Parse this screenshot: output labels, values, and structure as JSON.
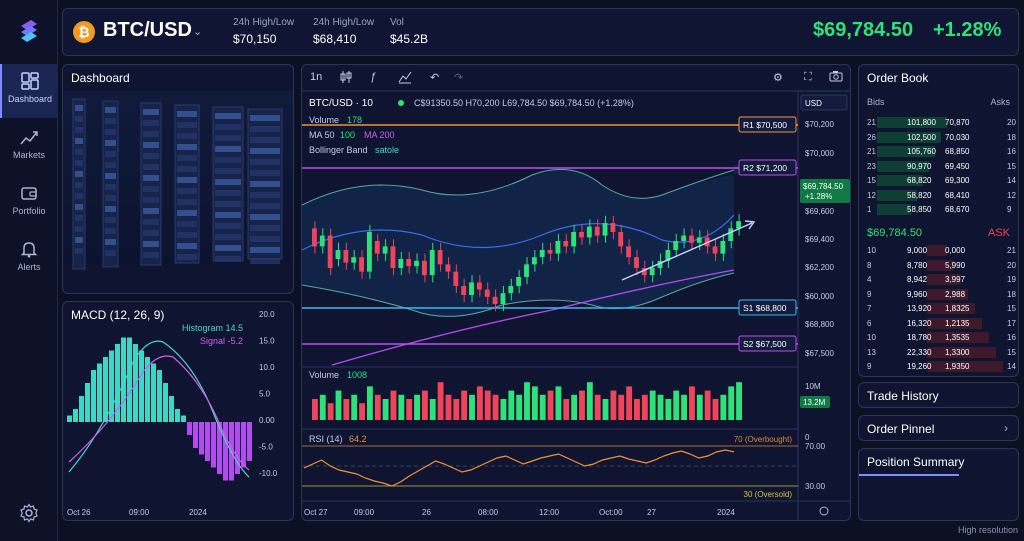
{
  "nav": {
    "items": [
      {
        "label": "Dashboard",
        "icon": "dashboard-icon"
      },
      {
        "label": "Markets",
        "icon": "chart-icon"
      },
      {
        "label": "Portfolio",
        "icon": "wallet-icon"
      },
      {
        "label": "Alerts",
        "icon": "bell-icon"
      }
    ]
  },
  "header": {
    "coin_symbol": "₿",
    "pair": "BTC/USD",
    "stats": [
      {
        "label": "24h High/Low",
        "value": "$70,150"
      },
      {
        "label": "24h High/Low",
        "value": "$68,410"
      },
      {
        "label": "Vol",
        "value": "$45.2B"
      }
    ],
    "price": "$69,784.50",
    "change": "+1.28%"
  },
  "dashboard": {
    "title": "Dashboard"
  },
  "macd": {
    "title": "MACD (12, 26, 9)",
    "histogram_label": "Histogram 14.5",
    "signal_label": "Signal -5.2",
    "yticks": [
      "20.0",
      "15.0",
      "10.0",
      "5.0",
      "0.00",
      "-5.0",
      "-10.0"
    ],
    "xticks": [
      "Oct 26",
      "09:00",
      "2024"
    ]
  },
  "chart_toolbar": {
    "interval": "1n"
  },
  "chart": {
    "legend": {
      "pair_label": "BTC/USD · 10",
      "ohlc": "C$91350.50  H70,200  L69,784.50  $69,784.50 (+1.28%)",
      "volume_label": "Volume",
      "volume_value": "178",
      "ma_label": "MA 50",
      "ma_value": "100",
      "ma2_label": "MA 200",
      "bb_label": "Bollinger Band",
      "bb_value": "satole"
    },
    "currency": "USD",
    "price_axis": [
      "$70,200",
      "$70,000",
      "$69,600",
      "$69,400",
      "$62,200",
      "$60,000",
      "$68,800",
      "$67,500"
    ],
    "levels": [
      {
        "label": "R1 $70,500",
        "color": "#f0923a"
      },
      {
        "label": "R2 $71,200",
        "color": "#c04cf0"
      },
      {
        "label": "S1 $68,800",
        "color": "#3ab8f0"
      },
      {
        "label": "S2 $67,500",
        "color": "#c04cf0"
      }
    ],
    "price_tag": "$69,784.50",
    "price_tag_change": "+1.28%",
    "volume_title": "Volume",
    "volume_value": "1008",
    "volume_axis": [
      "10M",
      "13.2M",
      "0"
    ],
    "rsi_title": "RSI (14)",
    "rsi_value": "64.2",
    "rsi_overbought": "70 (Overbought)",
    "rsi_oversold": "30 (Oversold)",
    "rsi_axis": [
      "70.00",
      "30.00"
    ],
    "time_axis": [
      "Oct 27",
      "09:00",
      "26",
      "08:00",
      "12:00",
      "Oct:00",
      "27",
      "2024"
    ]
  },
  "chart_data": {
    "type": "candlestick",
    "candles": [
      [
        0.62,
        0.52
      ],
      [
        0.52,
        0.58
      ],
      [
        0.58,
        0.4
      ],
      [
        0.45,
        0.5
      ],
      [
        0.5,
        0.43
      ],
      [
        0.43,
        0.46
      ],
      [
        0.46,
        0.38
      ],
      [
        0.38,
        0.6
      ],
      [
        0.55,
        0.48
      ],
      [
        0.48,
        0.52
      ],
      [
        0.52,
        0.4
      ],
      [
        0.4,
        0.45
      ],
      [
        0.45,
        0.41
      ],
      [
        0.41,
        0.44
      ],
      [
        0.44,
        0.36
      ],
      [
        0.36,
        0.5
      ],
      [
        0.5,
        0.42
      ],
      [
        0.42,
        0.38
      ],
      [
        0.38,
        0.3
      ],
      [
        0.3,
        0.25
      ],
      [
        0.25,
        0.32
      ],
      [
        0.32,
        0.28
      ],
      [
        0.28,
        0.24
      ],
      [
        0.24,
        0.2
      ],
      [
        0.2,
        0.26
      ],
      [
        0.26,
        0.3
      ],
      [
        0.3,
        0.35
      ],
      [
        0.35,
        0.42
      ],
      [
        0.42,
        0.46
      ],
      [
        0.46,
        0.5
      ],
      [
        0.5,
        0.48
      ],
      [
        0.48,
        0.55
      ],
      [
        0.55,
        0.52
      ],
      [
        0.52,
        0.6
      ],
      [
        0.6,
        0.57
      ],
      [
        0.57,
        0.63
      ],
      [
        0.63,
        0.58
      ],
      [
        0.58,
        0.65
      ],
      [
        0.65,
        0.6
      ],
      [
        0.6,
        0.52
      ],
      [
        0.52,
        0.46
      ],
      [
        0.46,
        0.4
      ],
      [
        0.4,
        0.36
      ],
      [
        0.36,
        0.4
      ],
      [
        0.4,
        0.44
      ],
      [
        0.44,
        0.5
      ],
      [
        0.5,
        0.55
      ],
      [
        0.55,
        0.58
      ],
      [
        0.58,
        0.54
      ],
      [
        0.54,
        0.57
      ],
      [
        0.57,
        0.52
      ],
      [
        0.52,
        0.48
      ],
      [
        0.48,
        0.55
      ],
      [
        0.55,
        0.62
      ],
      [
        0.62,
        0.66
      ]
    ],
    "volume": [
      5,
      6,
      4,
      7,
      5,
      6,
      4,
      8,
      6,
      5,
      7,
      6,
      5,
      6,
      7,
      5,
      9,
      6,
      5,
      7,
      6,
      8,
      7,
      6,
      5,
      7,
      6,
      9,
      8,
      6,
      7,
      8,
      5,
      6,
      7,
      9,
      6,
      5,
      7,
      6,
      8,
      5,
      6,
      7,
      6,
      5,
      7,
      6,
      8,
      6,
      7,
      5,
      6,
      8,
      9
    ],
    "rsi": [
      48,
      52,
      56,
      50,
      46,
      44,
      42,
      38,
      35,
      33,
      30,
      34,
      40,
      45,
      50,
      55,
      52,
      48,
      44,
      46,
      50,
      54,
      58,
      60,
      56,
      52,
      55,
      58,
      60,
      62,
      58,
      54,
      50,
      52,
      56,
      58,
      60,
      57,
      55,
      53,
      56,
      60,
      63,
      65,
      62,
      58,
      60,
      64,
      66,
      64.2
    ],
    "macd_histogram": [
      1,
      2,
      4,
      6,
      8,
      9,
      10,
      11,
      12,
      13,
      13,
      12,
      11,
      10,
      9,
      8,
      6,
      4,
      2,
      1,
      -2,
      -4,
      -5,
      -6,
      -7,
      -8,
      -9,
      -9,
      -8,
      -7,
      -6
    ],
    "ylim": [
      67500,
      71200
    ]
  },
  "orderbook": {
    "title": "Order Book",
    "bids_header": "Bids",
    "asks_header": "Asks",
    "bids_rows": [
      [
        "21",
        "101,800",
        "70,870",
        "20"
      ],
      [
        "26",
        "102,500",
        "70,030",
        "18"
      ],
      [
        "21",
        "105,760",
        "68,850",
        "16"
      ],
      [
        "23",
        "90,970",
        "69,450",
        "15"
      ],
      [
        "15",
        "68,820",
        "69,300",
        "14"
      ],
      [
        "12",
        "58,820",
        "68,410",
        "12"
      ],
      [
        "1",
        "58,850",
        "68,670",
        "9"
      ]
    ],
    "mid_price": "$69,784.50",
    "ask_label": "ASK",
    "asks_rows": [
      [
        "10",
        "9,000",
        "0,000",
        "21"
      ],
      [
        "8",
        "8,780",
        "5,990",
        "20"
      ],
      [
        "4",
        "8,942",
        "3,997",
        "19"
      ],
      [
        "9",
        "9,960",
        "2,988",
        "18"
      ],
      [
        "7",
        "13,920",
        "1,8325",
        "15"
      ],
      [
        "6",
        "16,320",
        "1,2135",
        "17"
      ],
      [
        "10",
        "18,780",
        "1,3535",
        "16"
      ],
      [
        "13",
        "22,330",
        "1,3300",
        "15"
      ],
      [
        "9",
        "19,260",
        "1,9350",
        "14"
      ]
    ]
  },
  "side_buttons": {
    "trade_history": "Trade History",
    "order_panel": "Order Pinnel",
    "position_summary": "Position Summary"
  },
  "footer": {
    "resolution": "High resolution"
  },
  "colors": {
    "up": "#2ee27a",
    "down": "#f0445a",
    "accent": "#7d8cff"
  }
}
